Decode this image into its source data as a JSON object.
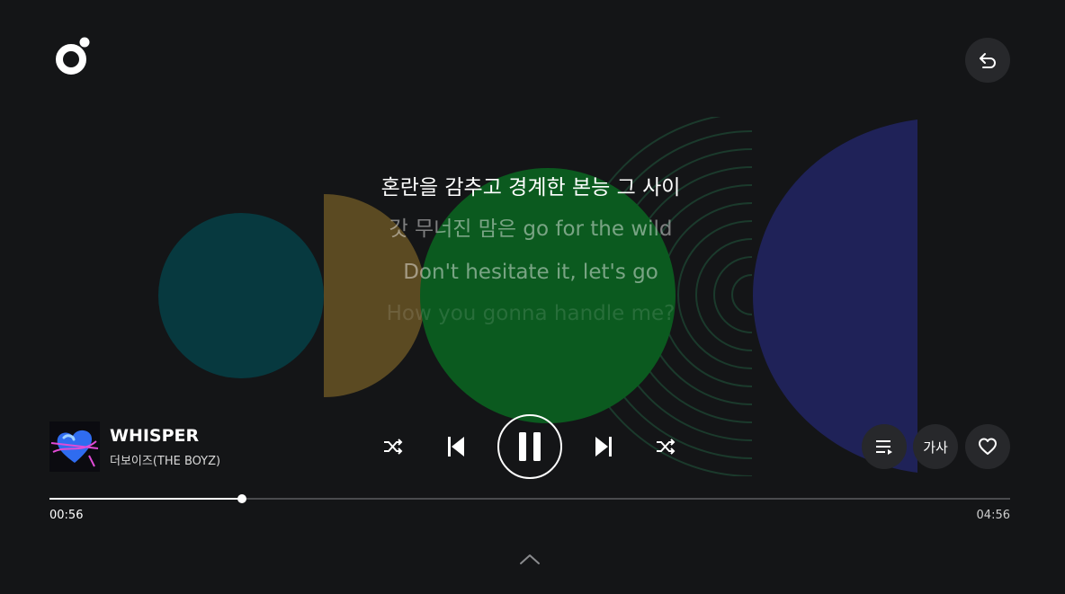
{
  "app": {
    "logo_icon": "music-app-logo",
    "back_icon": "undo-arrow-icon",
    "colors": {
      "background": "#141517",
      "button_bg": "#27282b",
      "teal_circle": "#07393f",
      "gold_half": "#5b4a22",
      "green_circle": "#0b5a1f",
      "navy_half": "#1f2258",
      "ring_stroke": "#1a3a2a"
    }
  },
  "lyrics": {
    "current": "혼란을 감추고 경계한 본능 그 사이",
    "next1": "갓 무너진 맘은 go for the wild",
    "next2": "Don't hesitate it, let's go",
    "next3": "How you gonna handle me?"
  },
  "track": {
    "title": "WHISPER",
    "artist": "더보이즈(THE BOYZ)",
    "album_art_icon": "blue-heart-album-art"
  },
  "controls": {
    "shuffle_left_icon": "shuffle-icon",
    "prev_icon": "skip-previous-icon",
    "play_state": "playing",
    "pause_icon": "pause-icon",
    "next_icon": "skip-next-icon",
    "shuffle_right_icon": "shuffle-icon",
    "playlist_icon": "playlist-icon",
    "lyrics_label": "가사",
    "like_icon": "heart-outline-icon"
  },
  "progress": {
    "current_time": "00:56",
    "total_time": "04:56",
    "fraction": 0.2
  },
  "expand_icon": "chevron-up-icon"
}
